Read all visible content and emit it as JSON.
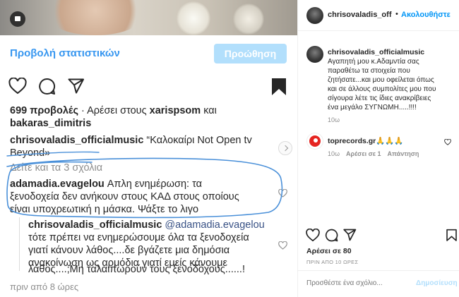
{
  "left": {
    "stats_link": "Προβολή στατιστικών",
    "promote_button": "Προώθηση",
    "views_line_1": {
      "count": "699 προβολές",
      "likes_prefix": " · Αρέσει στους ",
      "user1": "xarispsom",
      "and": " και"
    },
    "views_line_2": "bakaras_dimitris",
    "caption_line_1": {
      "user": "chrisovaladis_officialmusic",
      "text": " “Καλοκαίρι Not Open tv"
    },
    "caption_line_2": "Beyond»",
    "see_all": "Δείτε και τα 3 σχόλια",
    "comment": {
      "user": "adamadia.evagelou",
      "line1": " Απλη ενημέρωση: τα",
      "line2": "ξενοδοχεία δεν ανήκουν στους ΚΑΔ στους οποίους",
      "line3": "είναι υποχρεωτική η μάσκα. Ψάξτε το λιγο"
    },
    "reply": {
      "user": "chrisovaladis_officialmusic",
      "mention": " @adamadia.evagelou",
      "line2": "τότε πρέπει να ενημερώσουμε όλα τα ξενοδοχεία",
      "line3": "γιατί κάνουν λάθος....δε βγάζετε μια δημόσια",
      "line4": "ανακοίνωση ως αρμόδια γιατί εμείς κάνουμε",
      "line5": "λάθος....;Μη ταλαιπωρούν τους ξενοδόχους......!"
    },
    "time_ago": "πριν από 8 ώρες",
    "colors": {
      "link": "#3897f0",
      "promote_bg": "#b2dffc",
      "annotation": "#4a90d9"
    }
  },
  "right": {
    "header": {
      "username": "chrisovaladis_off",
      "dot": "•",
      "follow": "Ακολουθήστε"
    },
    "caption": {
      "user": "chrisovaladis_officialmusic",
      "lines": [
        "Αγαπητή μου κ.Αδαμντία σας",
        "παραθέτω τα στοιχεία που",
        "ζητήσατε...και μου οφείλεται όπως",
        "και σε άλλους συμπολίτες μου που",
        "σίγουρα λέτε τις ίδιες ανακρίβειες",
        "ένα μεγάλο ΣΥΓΝΩΜΗ.....!!!!"
      ],
      "time": "10ω"
    },
    "comment": {
      "user": "toprecords.gr",
      "text": "🙏🙏🙏",
      "time": "10ω",
      "likes": "Αρέσει σε 1",
      "reply": "Απάντηση"
    },
    "likes": "Αρέσει σε 80",
    "date": "ΠΡΙΝ ΑΠΟ 10 ΩΡΕΣ",
    "comment_placeholder": "Προσθέστε ένα σχόλιο...",
    "post_button": "Δημοσίευση",
    "colors": {
      "follow": "#0095f6",
      "post_disabled": "#b2dffc"
    }
  }
}
